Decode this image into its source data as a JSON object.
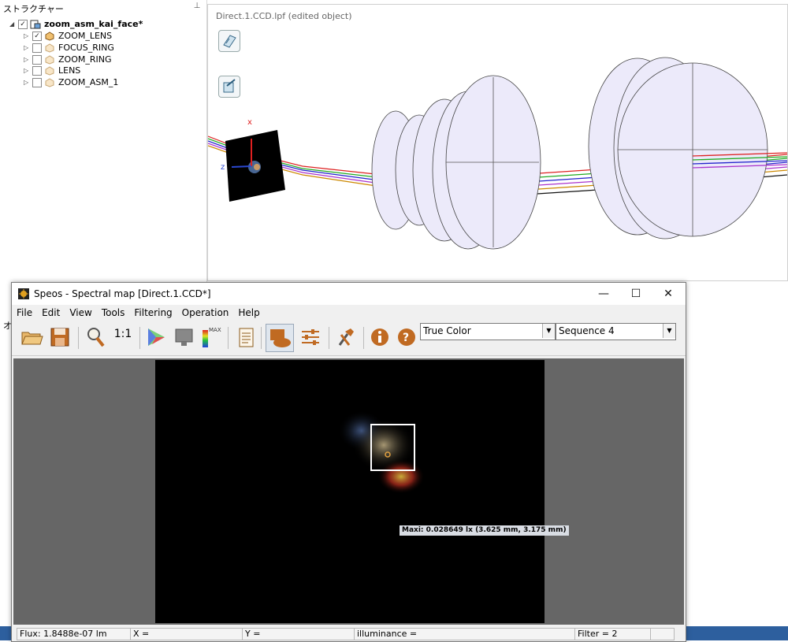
{
  "structure": {
    "title": "ストラクチャー",
    "pin": "⊥",
    "root": {
      "label": "zoom_asm_kai_face*",
      "checked": true
    },
    "children": [
      {
        "label": "ZOOM_LENS",
        "checked": true
      },
      {
        "label": "FOCUS_RING",
        "checked": false
      },
      {
        "label": "ZOOM_RING",
        "checked": false
      },
      {
        "label": "LENS",
        "checked": false
      },
      {
        "label": "ZOOM_ASM_1",
        "checked": false
      }
    ]
  },
  "viewport": {
    "title": "Direct.1.CCD.lpf (edited object)",
    "axis_x": "x",
    "axis_z": "z"
  },
  "underlying": {
    "left_letter": "オ"
  },
  "speos": {
    "title": "Speos - Spectral map [Direct.1.CCD*]",
    "menu": [
      "File",
      "Edit",
      "View",
      "Tools",
      "Filtering",
      "Operation",
      "Help"
    ],
    "combo_color": "True Color",
    "combo_sequence": "Sequence 4",
    "scale_label": "1:1",
    "max_label": "MAX",
    "marker": "Maxi: 0.028649 lx (3.625 mm, 3.175 mm)",
    "status": {
      "flux": "Flux: 1.8488e-07 lm",
      "x": "X =",
      "y": "Y =",
      "illuminance": "illuminance =",
      "filter": "Filter = 2"
    }
  },
  "colors": {
    "toolbar_accent": "#c06a22",
    "map_background": "#666666",
    "taskbar": "#2d5f9e"
  }
}
